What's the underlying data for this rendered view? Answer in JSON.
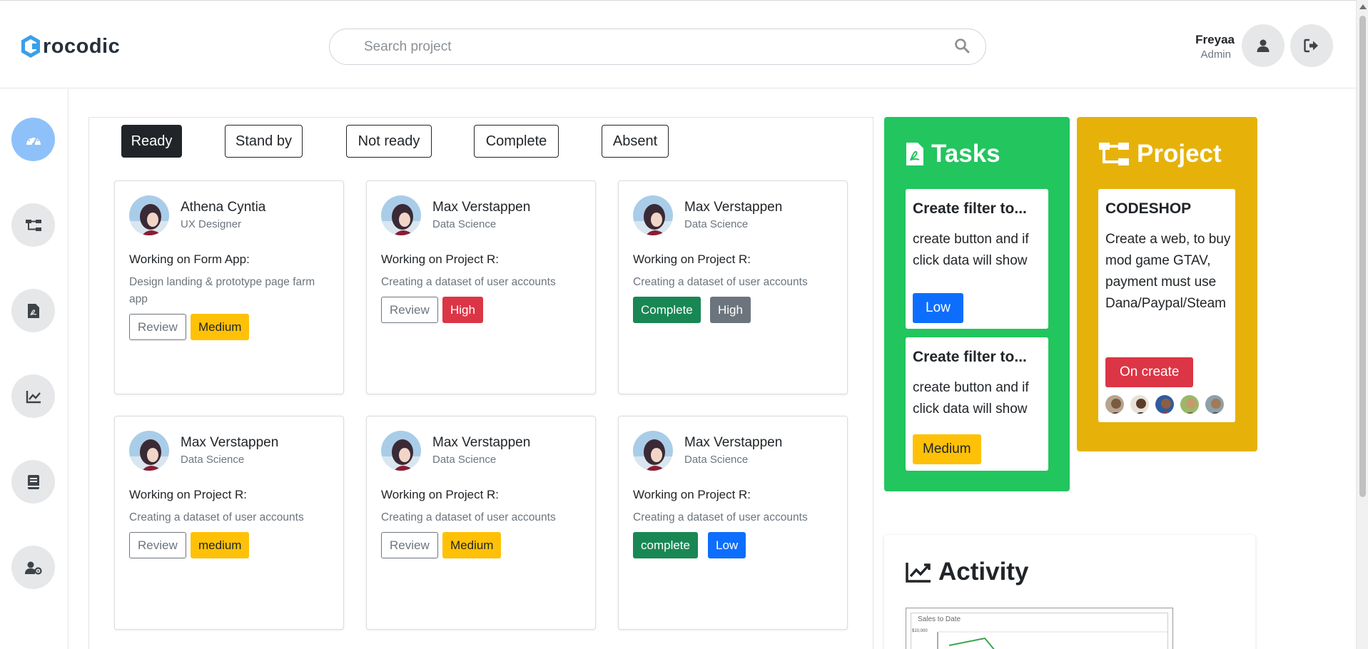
{
  "brand": {
    "logo_letter": "C",
    "logo_rest": "rocodic"
  },
  "search": {
    "placeholder": "Search project"
  },
  "user": {
    "name": "Freyaa",
    "role": "Admin"
  },
  "sidebar": {
    "items": [
      "dashboard-icon",
      "project-tree-icon",
      "pdf-file-icon",
      "chart-line-icon",
      "book-icon",
      "user-gear-icon"
    ]
  },
  "filters": [
    "Ready",
    "Stand by",
    "Not ready",
    "Complete",
    "Absent"
  ],
  "members": [
    {
      "name": "Athena Cyntia",
      "role": "UX Designer",
      "work": "Working on Form App:",
      "desc": "Design landing & prototype page farm app",
      "status": "Review",
      "priority": "Medium"
    },
    {
      "name": "Max Verstappen",
      "role": "Data Science",
      "work": "Working on Project R:",
      "desc": "Creating a dataset of user accounts",
      "status": "Review",
      "priority": "High"
    },
    {
      "name": "Max Verstappen",
      "role": "Data Science",
      "work": "Working on Project R:",
      "desc": "Creating a dataset of user accounts",
      "status": "Complete",
      "priority": "High"
    },
    {
      "name": "Max Verstappen",
      "role": "Data Science",
      "work": "Working on Project R:",
      "desc": "Creating a dataset of user accounts",
      "status": "Review",
      "priority": "medium"
    },
    {
      "name": "Max Verstappen",
      "role": "Data Science",
      "work": "Working on Project R:",
      "desc": "Creating a dataset of user accounts",
      "status": "Review",
      "priority": "Medium"
    },
    {
      "name": "Max Verstappen",
      "role": "Data Science",
      "work": "Working on Project R:",
      "desc": "Creating a dataset of user accounts",
      "status": "complete",
      "priority": "Low"
    }
  ],
  "tasks": {
    "title": "Tasks",
    "items": [
      {
        "title": "Create filter to...",
        "desc": "create button and if click data will show",
        "priority": "Low"
      },
      {
        "title": "Create filter to...",
        "desc": "create button and if click data will show",
        "priority": "Medium"
      }
    ]
  },
  "project": {
    "title": "Project",
    "card": {
      "title": "CODESHOP",
      "desc": "Create a web, to buy mod game GTAV, payment must use Dana/Paypal/Steam",
      "status": "On create"
    }
  },
  "activity": {
    "title": "Activity",
    "chart_title": "Sales to Date",
    "chart_y_tick": "$10,000"
  },
  "colors": {
    "tasks_bg": "#22c55e",
    "project_bg": "#e6b20a",
    "active_filter": "#212529",
    "active_side": "#8ec1fa"
  }
}
